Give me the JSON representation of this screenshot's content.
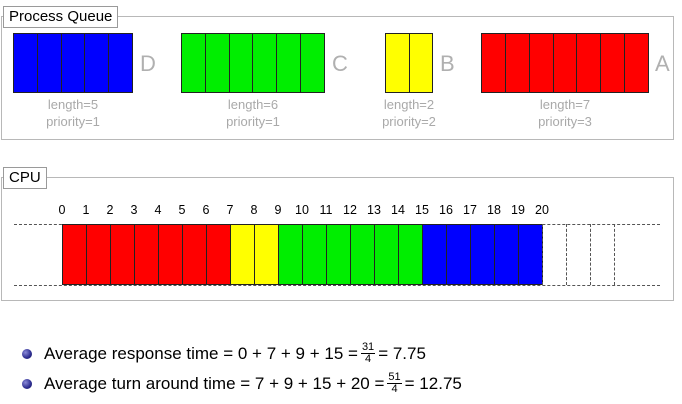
{
  "queue": {
    "title": "Process Queue",
    "processes": [
      {
        "name": "D",
        "length_text": "length=5",
        "priority_text": "priority=1",
        "length": 5,
        "color": "#0000ff"
      },
      {
        "name": "C",
        "length_text": "length=6",
        "priority_text": "priority=1",
        "length": 6,
        "color": "#00ee00"
      },
      {
        "name": "B",
        "length_text": "length=2",
        "priority_text": "priority=2",
        "length": 2,
        "color": "#ffff00"
      },
      {
        "name": "A",
        "length_text": "length=7",
        "priority_text": "priority=3",
        "length": 7,
        "color": "#ff0000"
      }
    ]
  },
  "cpu": {
    "title": "CPU",
    "ticks": [
      "0",
      "1",
      "2",
      "3",
      "4",
      "5",
      "6",
      "7",
      "8",
      "9",
      "10",
      "11",
      "12",
      "13",
      "14",
      "15",
      "16",
      "17",
      "18",
      "19",
      "20"
    ],
    "schedule": [
      {
        "process": "A",
        "start": 0,
        "end": 7,
        "color": "#ff0000"
      },
      {
        "process": "B",
        "start": 7,
        "end": 9,
        "color": "#ffff00"
      },
      {
        "process": "C",
        "start": 9,
        "end": 15,
        "color": "#00ee00"
      },
      {
        "process": "D",
        "start": 15,
        "end": 20,
        "color": "#0000ff"
      }
    ],
    "empty_slots": 3
  },
  "stats": {
    "response_prefix": "Average response time = 0 + 7 + 9 + 15 = ",
    "response_num": "31",
    "response_den": "4",
    "response_result": " = 7.75",
    "turnaround_prefix": "Average turn around time = 7 + 9 + 15 + 20 = ",
    "turnaround_num": "51",
    "turnaround_den": "4",
    "turnaround_result": " = 12.75"
  }
}
